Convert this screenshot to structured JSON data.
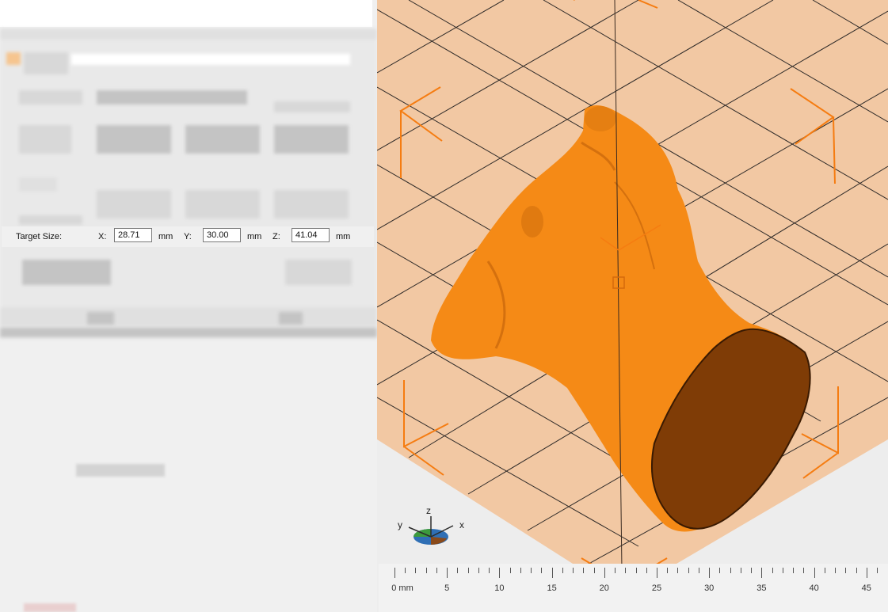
{
  "target_size": {
    "label": "Target Size:",
    "x": {
      "label": "X:",
      "value": "28.71",
      "unit": "mm"
    },
    "y": {
      "label": "Y:",
      "value": "30.00",
      "unit": "mm"
    },
    "z": {
      "label": "Z:",
      "value": "41.04",
      "unit": "mm"
    }
  },
  "axis_gizmo": {
    "x": "x",
    "y": "y",
    "z": "z"
  },
  "ruler": {
    "labels": [
      "0 mm",
      "5",
      "10",
      "15",
      "20",
      "25",
      "30",
      "35",
      "40",
      "45"
    ]
  },
  "colors": {
    "bed": "#f2c8a3",
    "model": "#f58a16",
    "cut_face": "#7f3c06",
    "bounding_box": "#f57c11"
  }
}
